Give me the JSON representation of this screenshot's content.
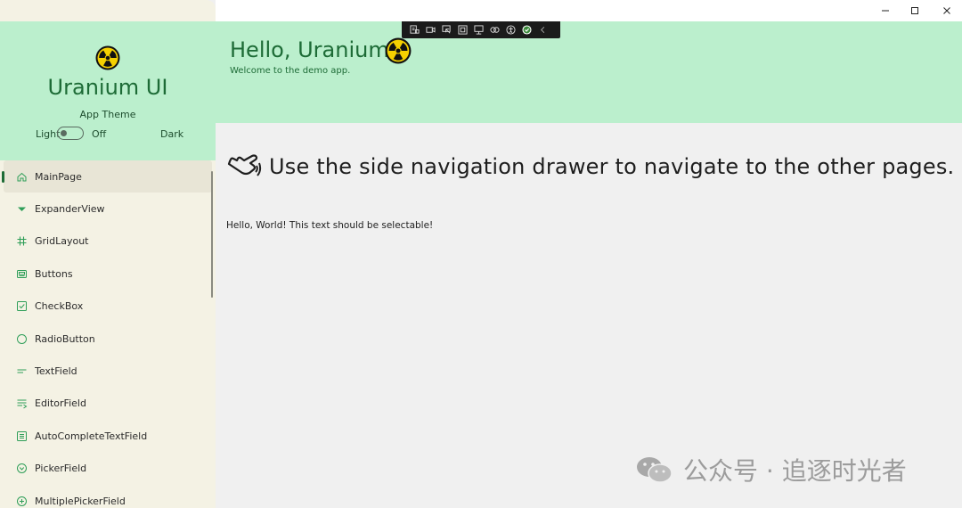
{
  "window": {
    "controls": {
      "minimize_icon": "minimize-icon",
      "maximize_icon": "maximize-icon",
      "close_icon": "close-icon"
    }
  },
  "sidebar": {
    "app_name": "Uranium UI",
    "theme_label": "App Theme",
    "theme_light": "Light",
    "theme_toggle_state": "Off",
    "theme_dark": "Dark",
    "items": [
      {
        "label": "MainPage",
        "icon": "home-icon",
        "active": true
      },
      {
        "label": "ExpanderView",
        "icon": "caret-down-icon"
      },
      {
        "label": "GridLayout",
        "icon": "grid-hash-icon"
      },
      {
        "label": "Buttons",
        "icon": "buttons-icon"
      },
      {
        "label": "CheckBox",
        "icon": "checkbox-icon"
      },
      {
        "label": "RadioButton",
        "icon": "radio-icon"
      },
      {
        "label": "TextField",
        "icon": "text-field-icon"
      },
      {
        "label": "EditorField",
        "icon": "editor-field-icon"
      },
      {
        "label": "AutoCompleteTextField",
        "icon": "autocomplete-icon"
      },
      {
        "label": "PickerField",
        "icon": "picker-icon"
      },
      {
        "label": "MultiplePickerField",
        "icon": "multi-picker-icon"
      }
    ]
  },
  "header": {
    "title": "Hello, Uranium!",
    "subtitle": "Welcome to the demo app."
  },
  "main": {
    "hint": "Use the side navigation drawer to navigate to the other pages.",
    "selectable_text": "Hello, World! This text should be selectable!"
  },
  "watermark": {
    "text": "公众号 · 追逐时光者"
  },
  "colors": {
    "accent_green": "#1d6b36",
    "header_bg": "#bbefcd",
    "sidebar_bg": "#f4f2e4",
    "content_bg": "#f0f0f0",
    "radiation_yellow": "#f5d000"
  }
}
